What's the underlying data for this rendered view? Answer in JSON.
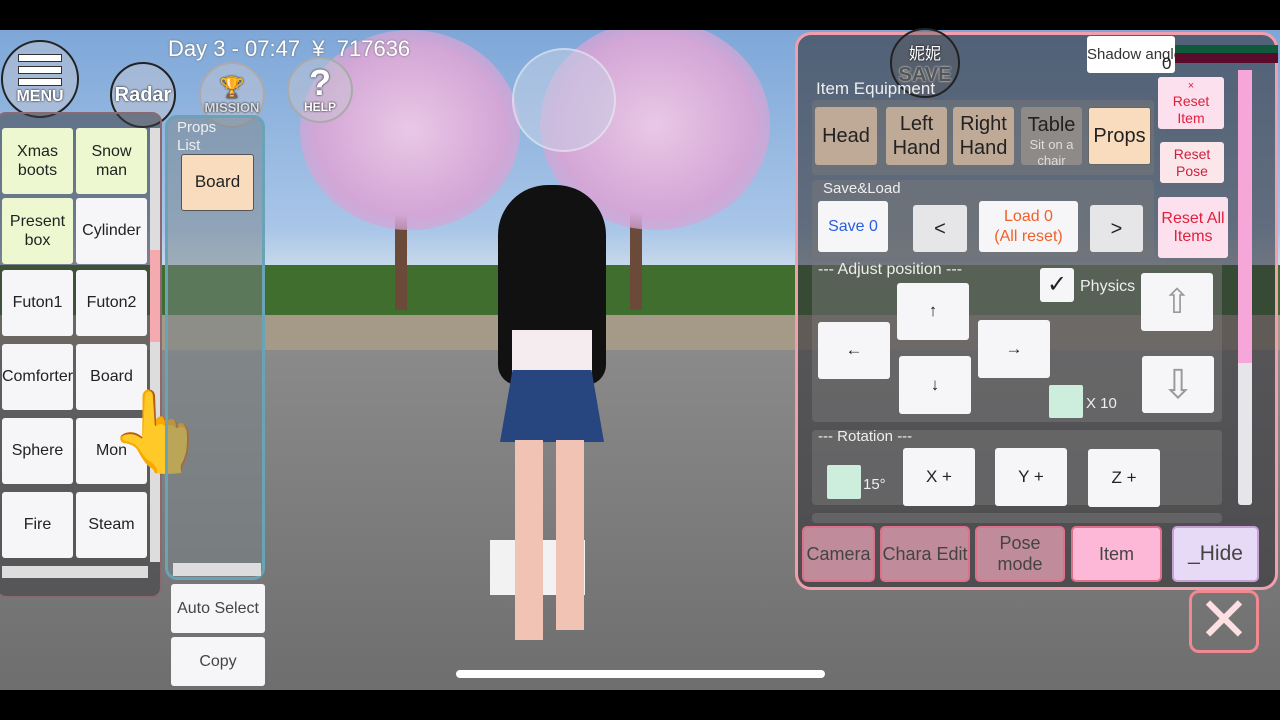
{
  "hud": {
    "status": "Day 3 - 07:47  ¥  717636",
    "menu": "MENU",
    "radar": "Radar",
    "mission": "MISSION",
    "help": "HELP",
    "save_top": "妮妮",
    "save": "SAVE"
  },
  "item_list": {
    "items": [
      "Xmas boots",
      "Snow man",
      "Present box",
      "Cylinder",
      "Futon1",
      "Futon2",
      "Comforter",
      "Board",
      "Sphere",
      "Mon",
      "Fire",
      "Steam"
    ],
    "scroll_fraction": 0.3
  },
  "props_list": {
    "title": "Props List",
    "items": [
      "Board"
    ],
    "auto_select": "Auto Select",
    "copy": "Copy"
  },
  "panel": {
    "shadow_angle": {
      "label": "Shadow angle",
      "value": "0"
    },
    "item_equipment": {
      "title": "Item Equipment",
      "tabs": [
        "Head",
        "Left Hand",
        "Right Hand",
        "Table",
        "Props"
      ],
      "table_sub": "Sit on a chair",
      "selected": "Props"
    },
    "reset_item_x": "×",
    "reset_item": "Reset Item",
    "reset_pose": "Reset Pose",
    "save_load": {
      "title": "Save&Load",
      "save": "Save 0",
      "prev": "<",
      "load": "Load 0\n(All reset)",
      "next": ">",
      "reset_all": "Reset All Items"
    },
    "adjust": {
      "title": "--- Adjust position ---",
      "up": "↑",
      "down": "↓",
      "left": "←",
      "right": "→",
      "physics": "Physics",
      "physics_checked": true,
      "x10": "X 10"
    },
    "rotation": {
      "title": "--- Rotation ---",
      "step": "15°",
      "x": "X +",
      "y": "Y +",
      "z": "Z +"
    },
    "bottom_tabs": [
      "Camera",
      "Chara Edit",
      "Pose mode",
      "Item",
      "_Hide"
    ],
    "active_tab": "Item"
  },
  "colors": {
    "accent_pink": "#f7a8cf",
    "peach": "#f8dcbd",
    "reset_red": "#e0203c",
    "save_blue": "#2a5de0",
    "load_orange": "#f0602a"
  }
}
